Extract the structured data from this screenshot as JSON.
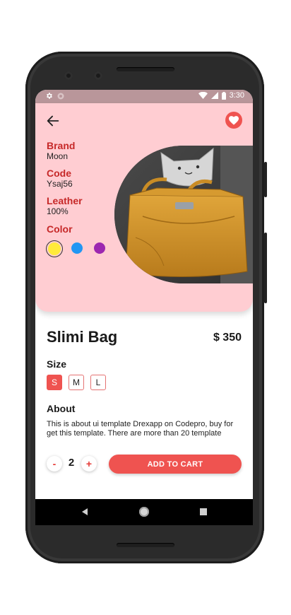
{
  "status_bar": {
    "time": "3:30",
    "icons": [
      "settings-icon",
      "sync-icon",
      "wifi-icon",
      "signal-icon",
      "battery-icon"
    ]
  },
  "header": {
    "back_icon": "arrow-left-icon",
    "favorite_icon": "heart-icon"
  },
  "specs": [
    {
      "key": "Brand",
      "value": "Moon"
    },
    {
      "key": "Code",
      "value": "Ysaj56"
    },
    {
      "key": "Leather",
      "value": "100%"
    }
  ],
  "color": {
    "label": "Color",
    "options": [
      "#ffeb3b",
      "#2196f3",
      "#9c27b0"
    ],
    "selected_index": 0
  },
  "product": {
    "title": "Slimi Bag",
    "price": "$ 350"
  },
  "size": {
    "label": "Size",
    "options": [
      "S",
      "M",
      "L"
    ],
    "selected": "S"
  },
  "about": {
    "label": "About",
    "text": "This is about ui template Drexapp on Codepro, buy for get this template. There are more than 20 template"
  },
  "quantity": {
    "minus_label": "-",
    "value": "2",
    "plus_label": "+"
  },
  "cart": {
    "label": "ADD TO CART"
  },
  "theme": {
    "accent": "#ef5350",
    "hero_background": "#ffcdd2",
    "label_color": "#c62828"
  }
}
